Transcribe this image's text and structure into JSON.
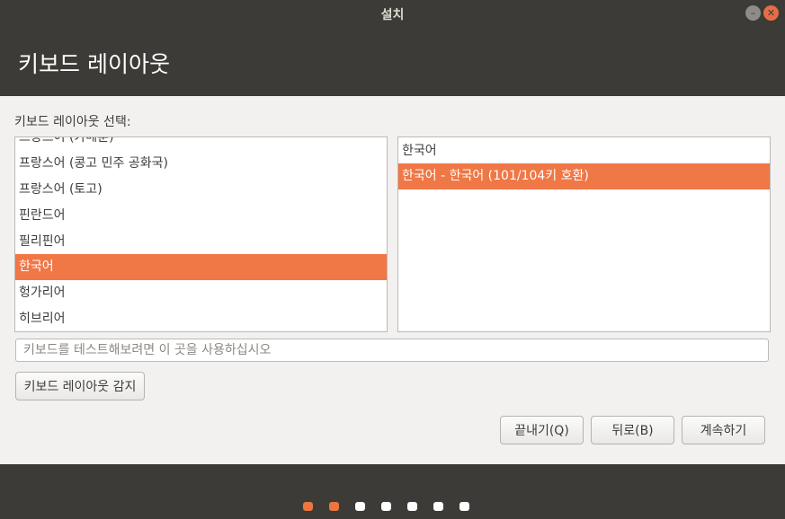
{
  "window": {
    "title": "설치",
    "minimize_label": "–",
    "close_label": "✕"
  },
  "header": {
    "title": "키보드 레이아웃"
  },
  "section_label": "키보드 레이아웃 선택:",
  "layout_list": [
    {
      "label": "프랑스어 (카메룬)",
      "selected": false
    },
    {
      "label": "프랑스어 (콩고 민주 공화국)",
      "selected": false
    },
    {
      "label": "프랑스어 (토고)",
      "selected": false
    },
    {
      "label": "핀란드어",
      "selected": false
    },
    {
      "label": "필리핀어",
      "selected": false
    },
    {
      "label": "한국어",
      "selected": true
    },
    {
      "label": "헝가리어",
      "selected": false
    },
    {
      "label": "히브리어",
      "selected": false
    }
  ],
  "variant_list": [
    {
      "label": "한국어",
      "selected": false
    },
    {
      "label": "한국어 - 한국어 (101/104키 호환)",
      "selected": true
    }
  ],
  "test_input": {
    "placeholder": "키보드를 테스트해보려면 이 곳을 사용하십시오",
    "value": ""
  },
  "buttons": {
    "detect": "키보드 레이아웃 감지",
    "quit": "끝내기(Q)",
    "back": "뒤로(B)",
    "continue": "계속하기"
  },
  "progress": {
    "total_steps": 7,
    "completed_steps": 2,
    "active_color": "#e9773f",
    "inactive_color": "#ffffff"
  },
  "colors": {
    "accent": "#f07746",
    "titlebar": "#3c3b37",
    "content_bg": "#f2f1f0"
  }
}
